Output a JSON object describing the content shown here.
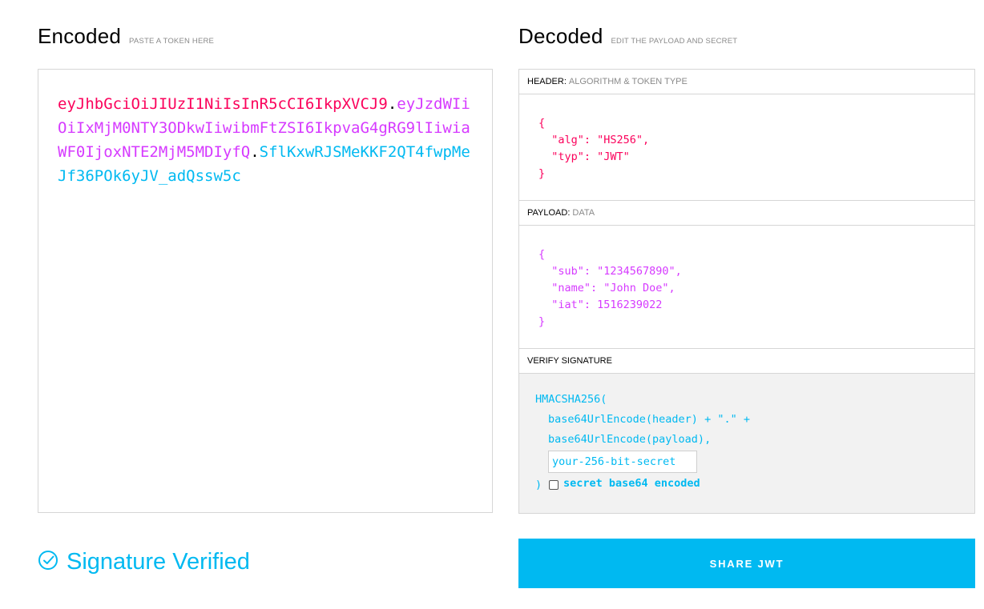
{
  "encoded": {
    "title": "Encoded",
    "subtitle": "PASTE A TOKEN HERE",
    "token": {
      "header": "eyJhbGciOiJIUzI1NiIsInR5cCI6IkpXVCJ9",
      "payload": "eyJzdWIiOiIxMjM0NTY3ODkwIiwibmFtZSI6IkpvaG4gRG9lIiwiaWF0IjoxNTE2MjM5MDIyfQ",
      "signature": "SflKxwRJSMeKKF2QT4fwpMeJf36POk6yJV_adQssw5c",
      "dot": "."
    }
  },
  "decoded": {
    "title": "Decoded",
    "subtitle": "EDIT THE PAYLOAD AND SECRET",
    "header_section": {
      "label": "HEADER:",
      "sublabel": "ALGORITHM & TOKEN TYPE",
      "json": "{\n  \"alg\": \"HS256\",\n  \"typ\": \"JWT\"\n}"
    },
    "payload_section": {
      "label": "PAYLOAD:",
      "sublabel": "DATA",
      "json": "{\n  \"sub\": \"1234567890\",\n  \"name\": \"John Doe\",\n  \"iat\": 1516239022\n}"
    },
    "verify_section": {
      "label": "VERIFY SIGNATURE",
      "line1": "HMACSHA256(",
      "line2": "base64UrlEncode(header) + \".\" +",
      "line3": "base64UrlEncode(payload),",
      "secret_placeholder": "your-256-bit-secret",
      "close_paren": ")",
      "checkbox_label": "secret base64 encoded"
    }
  },
  "status": {
    "text": "Signature Verified",
    "icon": "check-circle-icon"
  },
  "share_button": "SHARE JWT",
  "colors": {
    "header": "#fb015b",
    "payload": "#d63aff",
    "signature": "#00b9f1"
  }
}
